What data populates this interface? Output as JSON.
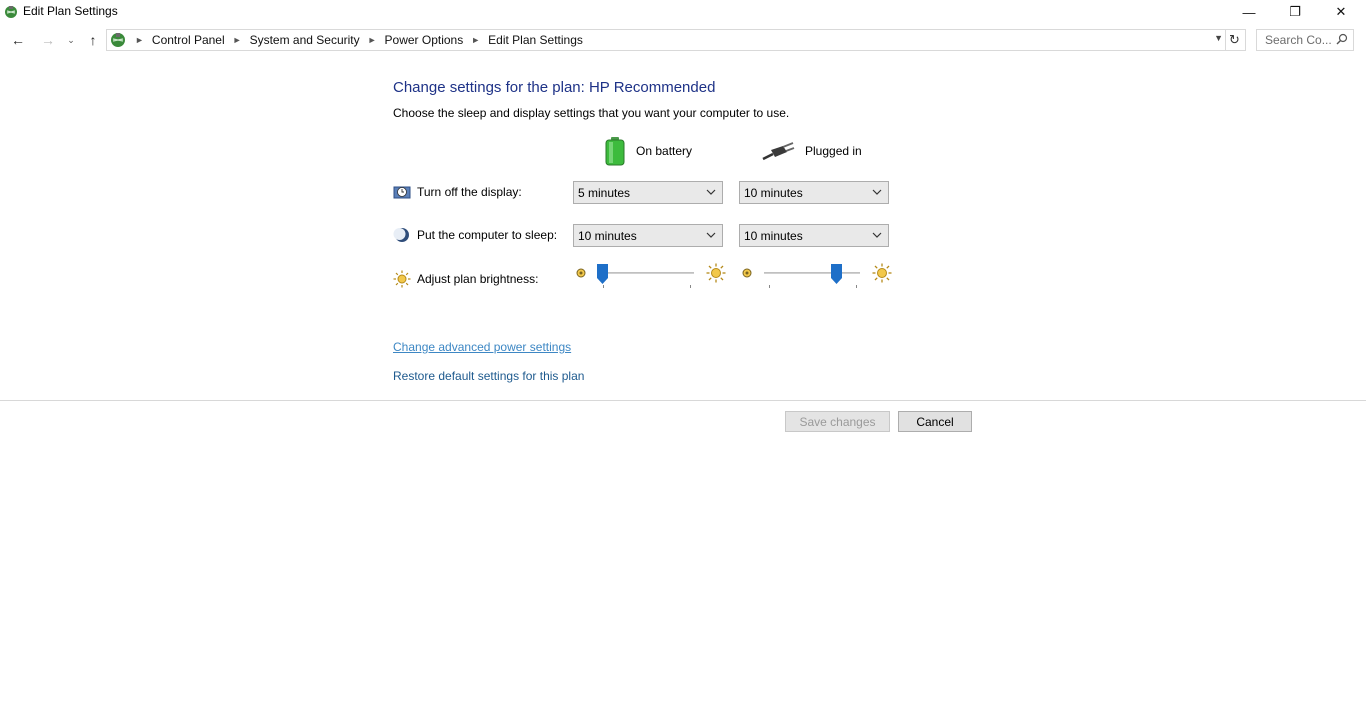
{
  "window": {
    "title": "Edit Plan Settings",
    "controls": {
      "minimize": "—",
      "maximize": "❐",
      "close": "✕"
    }
  },
  "nav": {
    "back": "←",
    "forward": "→",
    "recent": "⌄",
    "up": "↑",
    "breadcrumb": [
      "Control Panel",
      "System and Security",
      "Power Options",
      "Edit Plan Settings"
    ],
    "refresh": "↻",
    "search_placeholder": "Search Co..."
  },
  "content": {
    "title": "Change settings for the plan: HP Recommended",
    "subtitle": "Choose the sleep and display settings that you want your computer to use.",
    "columns": {
      "battery": "On battery",
      "plugged": "Plugged in"
    },
    "rows": {
      "display": {
        "label": "Turn off the display:",
        "battery": "5 minutes",
        "plugged": "10 minutes"
      },
      "sleep": {
        "label": "Put the computer to sleep:",
        "battery": "10 minutes",
        "plugged": "10 minutes"
      },
      "brightness": {
        "label": "Adjust plan brightness:",
        "battery_level": 0.05,
        "plugged_level": 0.75
      }
    },
    "links": {
      "advanced": "Change advanced power settings",
      "restore": "Restore default settings for this plan"
    },
    "buttons": {
      "save": "Save changes",
      "cancel": "Cancel"
    }
  },
  "colors": {
    "title_blue": "#1e3287",
    "link_blue": "#3d87c4",
    "slider_thumb": "#1e6fc8",
    "battery_green": "#3dbb3d"
  },
  "icons": [
    "power-options-icon",
    "battery-icon",
    "plug-icon",
    "display-timer-icon",
    "sleep-moon-icon",
    "brightness-sun-icon",
    "search-icon"
  ]
}
